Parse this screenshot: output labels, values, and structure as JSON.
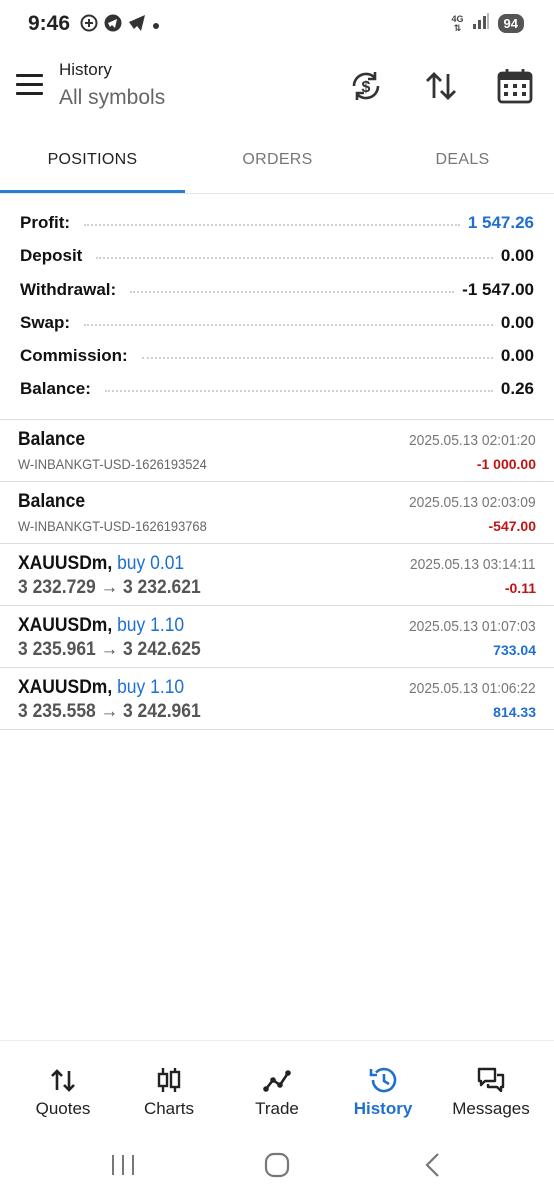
{
  "status": {
    "time": "9:46",
    "network": "4G",
    "battery": "94"
  },
  "header": {
    "title": "History",
    "subtitle": "All symbols"
  },
  "tabs": [
    {
      "label": "POSITIONS",
      "active": true
    },
    {
      "label": "ORDERS",
      "active": false
    },
    {
      "label": "DEALS",
      "active": false
    }
  ],
  "summary": [
    {
      "label": "Profit:",
      "value": "1 547.26"
    },
    {
      "label": "Deposit",
      "value": "0.00"
    },
    {
      "label": "Withdrawal:",
      "value": "-1 547.00"
    },
    {
      "label": "Swap:",
      "value": "0.00"
    },
    {
      "label": "Commission:",
      "value": "0.00"
    },
    {
      "label": "Balance:",
      "value": "0.26"
    }
  ],
  "deals": [
    {
      "title": "Balance",
      "side": "",
      "subtitle": "W-INBANKGT-USD-1626193524",
      "time": "2025.05.13 02:01:20",
      "amount": "-1 000.00"
    },
    {
      "title": "Balance",
      "side": "",
      "subtitle": "W-INBANKGT-USD-1626193768",
      "time": "2025.05.13 02:03:09",
      "amount": "-547.00"
    },
    {
      "title": "XAUUSDm,",
      "side": "buy 0.01",
      "subtitle": "3 232.729 → 3 232.621",
      "time": "2025.05.13 03:14:11",
      "amount": "-0.11"
    },
    {
      "title": "XAUUSDm,",
      "side": "buy 1.10",
      "subtitle": "3 235.961 → 3 242.625",
      "time": "2025.05.13 01:07:03",
      "amount": "733.04"
    },
    {
      "title": "XAUUSDm,",
      "side": "buy 1.10",
      "subtitle": "3 235.558 → 3 242.961",
      "time": "2025.05.13 01:06:22",
      "amount": "814.33"
    }
  ],
  "nav": [
    {
      "label": "Quotes",
      "icon": "quotes-icon"
    },
    {
      "label": "Charts",
      "icon": "charts-icon"
    },
    {
      "label": "Trade",
      "icon": "trade-icon"
    },
    {
      "label": "History",
      "icon": "history-icon",
      "active": true
    },
    {
      "label": "Messages",
      "icon": "messages-icon"
    }
  ],
  "colors": {
    "accent": "#1f6fd1",
    "negative": "#c01414",
    "tab_indicator": "#2a7fd4"
  }
}
